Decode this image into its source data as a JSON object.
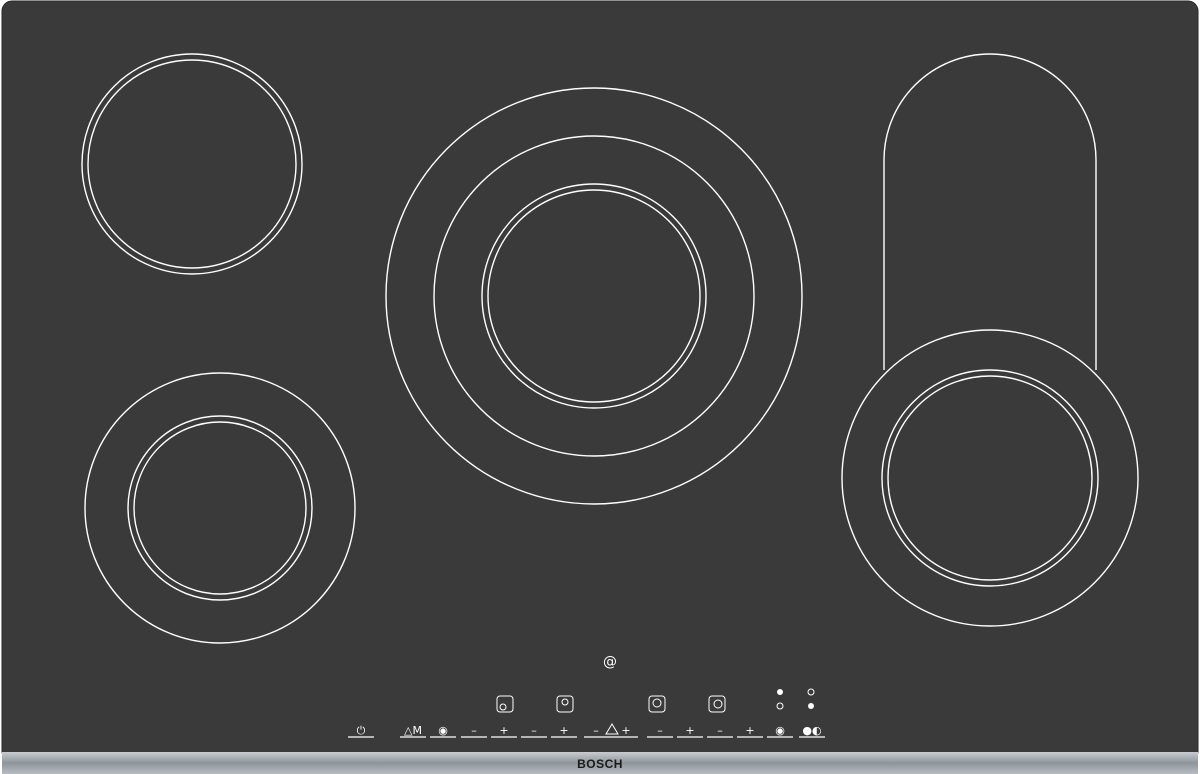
{
  "brand": "BOSCH",
  "logo_symbol": "@",
  "colors": {
    "glass": "#3a3a3a",
    "lines": "#ffffff",
    "trim": "#9aa0a6"
  },
  "zones": [
    {
      "name": "rear-left",
      "icon": "single-circle-zone"
    },
    {
      "name": "front-left",
      "icon": "dual-circle-zone"
    },
    {
      "name": "center",
      "icon": "triple-circle-zone"
    },
    {
      "name": "right",
      "icon": "extended-oval-zone"
    }
  ],
  "controls": [
    {
      "id": "power",
      "label": "⏻",
      "icon": "power-icon"
    },
    {
      "id": "memory",
      "label": "△M",
      "icon": "memory-icon"
    },
    {
      "id": "main-select",
      "label": "◉",
      "icon": "main-zone-icon"
    },
    {
      "id": "zone1-minus",
      "label": "–",
      "icon": "minus-icon"
    },
    {
      "id": "zone1-plus",
      "label": "+",
      "icon": "plus-icon"
    },
    {
      "id": "zone2-minus",
      "label": "–",
      "icon": "minus-icon"
    },
    {
      "id": "zone2-plus",
      "label": "+",
      "icon": "plus-icon"
    },
    {
      "id": "timer-minus",
      "label": "–",
      "icon": "minus-icon"
    },
    {
      "id": "timer-bell",
      "label": "🔔",
      "icon": "bell-icon"
    },
    {
      "id": "timer-plus",
      "label": "+",
      "icon": "plus-icon"
    },
    {
      "id": "zone3-minus",
      "label": "–",
      "icon": "minus-icon"
    },
    {
      "id": "zone3-plus",
      "label": "+",
      "icon": "plus-icon"
    },
    {
      "id": "zone4-minus",
      "label": "–",
      "icon": "minus-icon"
    },
    {
      "id": "zone4-plus",
      "label": "+",
      "icon": "plus-icon"
    },
    {
      "id": "dual-zone",
      "label": "◉",
      "icon": "dual-zone-icon"
    },
    {
      "id": "extend-zone",
      "label": "●◐",
      "icon": "extend-zone-icon"
    }
  ]
}
